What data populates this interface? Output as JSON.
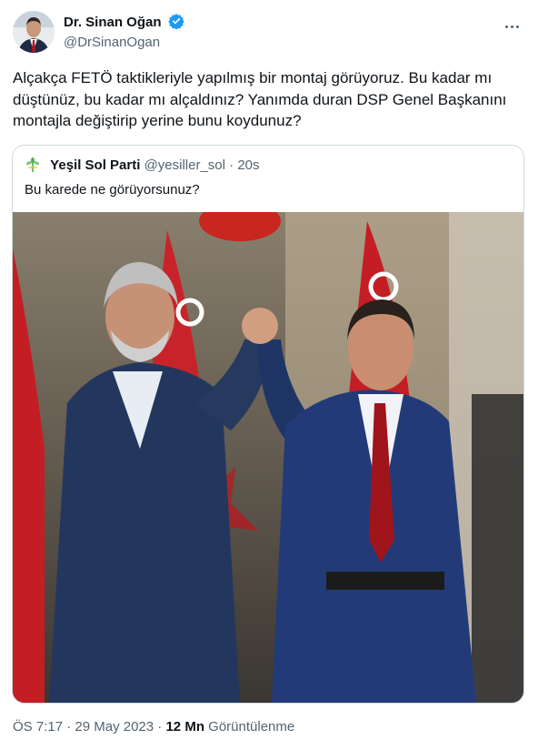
{
  "author": {
    "display_name": "Dr. Sinan Oğan",
    "handle": "@DrSinanOgan",
    "verified": true
  },
  "tweet": {
    "text": "Alçakça FETÖ taktikleriyle yapılmış bir montaj görüyoruz. Bu kadar mı düştünüz, bu kadar mı alçaldınız? Yanımda duran DSP Genel Başkanını montajla değiştirip yerine bunu koydunuz?"
  },
  "quoted_tweet": {
    "display_name": "Yeşil Sol Parti",
    "handle": "@yesiller_sol",
    "separator": "·",
    "time": "20s",
    "text": "Bu karede ne görüyorsunuz?"
  },
  "footer": {
    "time": "ÖS 7:17",
    "separator": "·",
    "date": "29 May 2023",
    "views_count": "12 Mn",
    "views_label": "Görüntülenme"
  },
  "colors": {
    "verified_blue": "#1d9bf0",
    "text_primary": "#0f1419",
    "text_secondary": "#536471",
    "border": "#cfd9de",
    "party_green": "#4caf50"
  },
  "icons": [
    "verified-badge-icon",
    "more-options-icon",
    "party-logo-icon"
  ]
}
